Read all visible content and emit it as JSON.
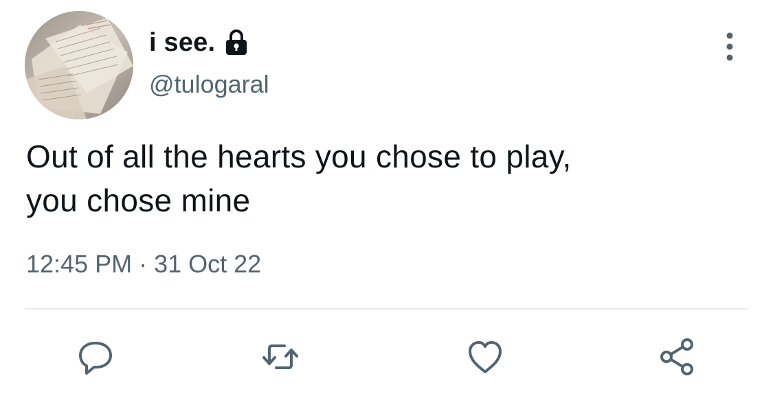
{
  "profile": {
    "display_name": "i see.",
    "handle": "@tulogaral",
    "protected_icon": "lock-icon",
    "avatar_icon": "avatar-photo"
  },
  "tweet": {
    "lines": [
      "Out of all the hearts you chose to play,",
      "you chose mine"
    ],
    "time": "12:45 PM",
    "separator": "·",
    "date": "31 Oct 22"
  },
  "actions": {
    "more": "more-options-icon",
    "reply": "reply-icon",
    "retweet": "retweet-icon",
    "like": "like-icon",
    "share": "share-icon"
  },
  "colors": {
    "text_primary": "#0f1419",
    "text_secondary": "#536471",
    "divider": "#e6e9eb",
    "icon": "#536471"
  }
}
